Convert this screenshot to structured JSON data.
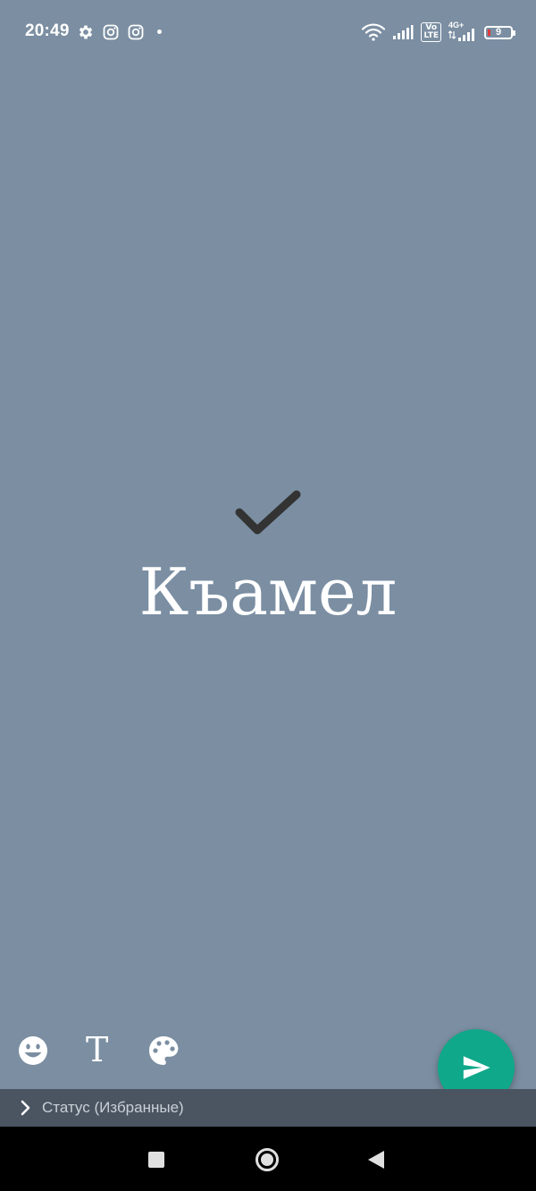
{
  "status_bar": {
    "time": "20:49",
    "network": "4G+",
    "volte": "Vo\nLTE",
    "battery_level": "9"
  },
  "status": {
    "text": "Къамел"
  },
  "audience": {
    "label": "Статус (Избранные)"
  },
  "colors": {
    "background": "#7b8ea2",
    "fab": "#0fa88a",
    "audience_bar": "#4a5561"
  }
}
